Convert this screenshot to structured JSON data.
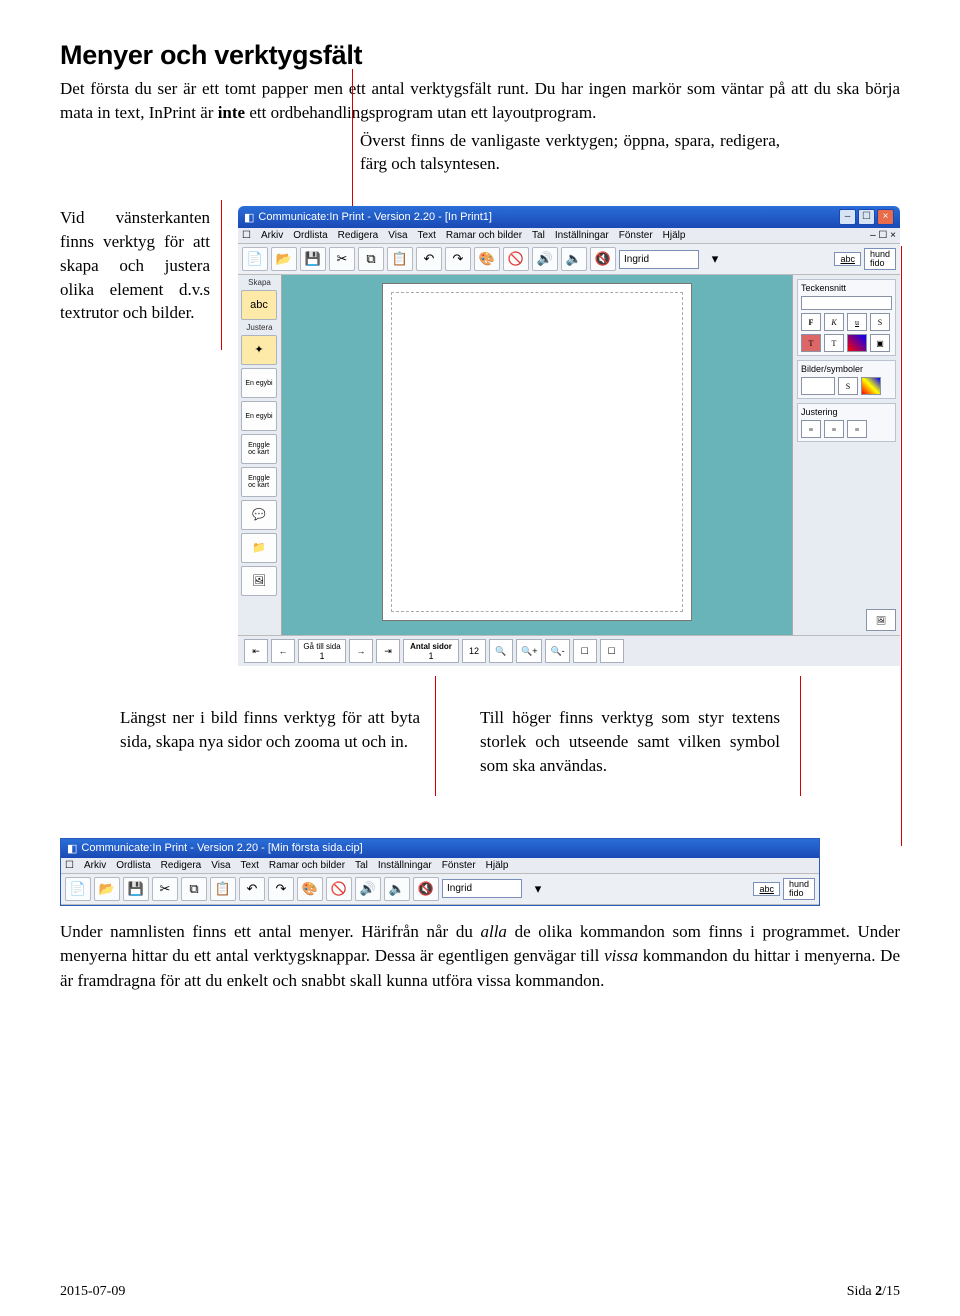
{
  "page": {
    "heading": "Menyer och verktygsfält",
    "intro_1": "Det första du ser är ett tomt papper men ett antal verktygsfält runt. Du har ingen markör som väntar på att du ska börja mata in text, InPrint är ",
    "intro_bold": "inte",
    "intro_2": " ett ordbehandlingsprogram utan ett layoutprogram."
  },
  "callouts": {
    "top": "Överst finns de vanligaste verktygen; öppna, spara, redigera, färg och talsyntesen.",
    "left": "Vid vänsterkanten finns verktyg för att skapa och justera olika element d.v.s textrutor och bilder.",
    "bottom_left": "Längst ner i bild finns verktyg för att byta sida, skapa nya sidor och zooma ut och in.",
    "bottom_right": "Till höger finns verktyg som styr textens storlek och utseende samt vilken symbol som ska användas."
  },
  "app": {
    "title": "Communicate:In Print - Version 2.20 - [In Print1]",
    "title2": "Communicate:In Print - Version 2.20 - [Min första sida.cip]",
    "menus": [
      "Arkiv",
      "Ordlista",
      "Redigera",
      "Visa",
      "Text",
      "Ramar och bilder",
      "Tal",
      "Inställningar",
      "Fönster",
      "Hjälp"
    ],
    "toolbar_user": "Ingrid",
    "toolbar_abc": "abc",
    "toolbar_words": "hund\nfido",
    "left_panel": {
      "skapa": "Skapa",
      "justera": "Justera",
      "btn1": "En egybi",
      "btn2": "En egybi",
      "btn3": "Enggle\noc kart",
      "btn4": "Enggle\noc kart"
    },
    "right_panel": {
      "teckensnitt": "Teckensnitt",
      "F": "F",
      "K": "K",
      "U": "u",
      "S": "S",
      "T_sup": "T",
      "bilder": "Bilder/symboler",
      "S2": "S",
      "justering": "Justering"
    },
    "bottom": {
      "ga_till_sida": "Gå till sida",
      "page_num": "1",
      "antal_sidor": "Antal sidor",
      "antal_sidor_val": "1",
      "n12": "12",
      "zoom": "ZOOM"
    }
  },
  "para_under": {
    "p1a": "Under namnlisten finns ett antal menyer. Härifrån når du ",
    "p1_ital1": "alla",
    "p1b": " de olika kommandon som finns i programmet. Under menyerna hittar du ett antal verktygsknappar. Dessa är egentligen genvägar till ",
    "p1_ital2": "vissa",
    "p1c": " kommandon du hittar i menyerna. De är framdragna för att du enkelt och snabbt skall kunna utföra vissa kommandon."
  },
  "footer": {
    "date": "2015-07-09",
    "page_label": "Sida ",
    "page_num": "2",
    "page_total": "/15"
  }
}
